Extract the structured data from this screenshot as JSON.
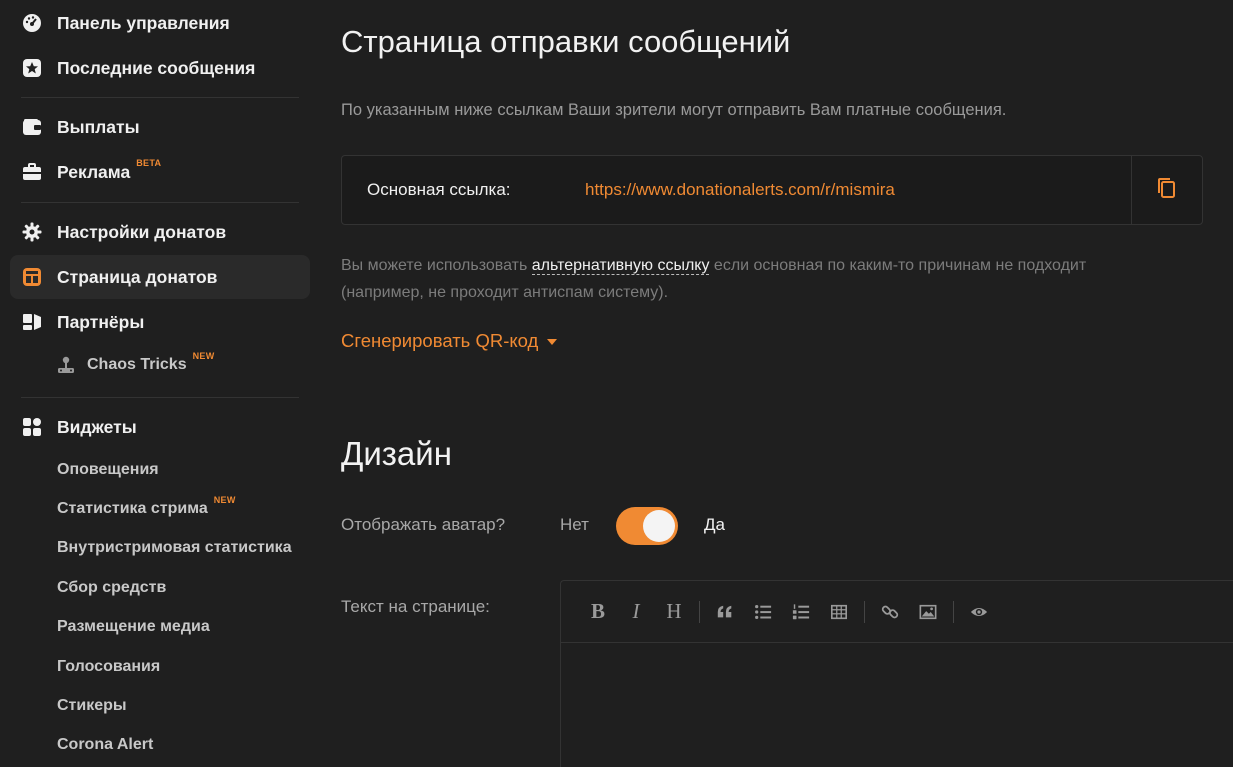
{
  "sidebar": {
    "items": [
      {
        "label": "Панель управления",
        "icon": "dashboard-icon"
      },
      {
        "label": "Последние сообщения",
        "icon": "star-icon"
      },
      {
        "label": "Выплаты",
        "icon": "wallet-icon"
      },
      {
        "label": "Реклама",
        "icon": "briefcase-icon",
        "badge": "BETA"
      },
      {
        "label": "Настройки донатов",
        "icon": "gear-icon"
      },
      {
        "label": "Страница донатов",
        "icon": "page-icon"
      },
      {
        "label": "Партнёры",
        "icon": "partners-icon"
      },
      {
        "label": "Виджеты",
        "icon": "widgets-icon"
      }
    ],
    "partners_sub": {
      "label": "Chaos Tricks",
      "badge": "NEW",
      "icon": "joystick-icon"
    },
    "widgets_sub": [
      {
        "label": "Оповещения"
      },
      {
        "label": "Статистика стрима",
        "badge": "NEW"
      },
      {
        "label": "Внутристримовая статистика"
      },
      {
        "label": "Сбор средств"
      },
      {
        "label": "Размещение медиа"
      },
      {
        "label": "Голосования"
      },
      {
        "label": "Стикеры"
      },
      {
        "label": "Corona Alert"
      }
    ],
    "accent_color": "#f08a33"
  },
  "main": {
    "title": "Страница отправки сообщений",
    "description": "По указанным ниже ссылкам Ваши зрители могут отправить Вам платные сообщения.",
    "link_label": "Основная ссылка:",
    "link_url": "https://www.donationalerts.com/r/mismira",
    "alt_prefix": "Вы можете использовать ",
    "alt_link": "альтернативную ссылку",
    "alt_suffix": " если основная по каким-то причинам не подходит (например, не проходит антиспам систему).",
    "qr_label": "Сгенерировать QR-код",
    "design_title": "Дизайн",
    "avatar_label": "Отображать аватар?",
    "toggle_no": "Нет",
    "toggle_yes": "Да",
    "avatar_enabled": true,
    "text_label": "Текст на странице:",
    "editor_tools": [
      "B",
      "I",
      "H"
    ]
  }
}
